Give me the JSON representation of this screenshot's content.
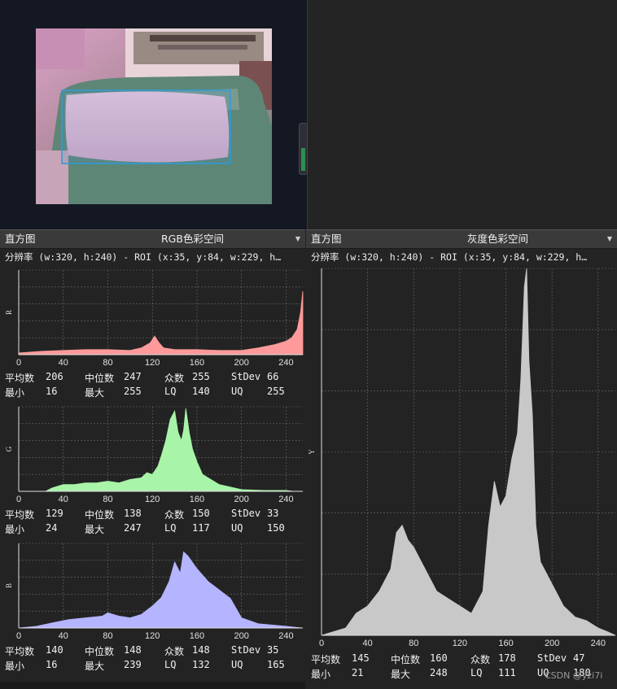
{
  "window": {
    "preview": {
      "roi_color": "#2f9ad8"
    }
  },
  "panels": [
    {
      "id": "rgb",
      "title": "直方图",
      "mode": "RGB色彩空间",
      "resolution": "分辨率 (w:320, h:240) - ROI (x:35, y:84, w:229, h…",
      "channels": [
        {
          "letter": "R",
          "color": "#ff9a9a",
          "x_ticks": [
            "0",
            "40",
            "80",
            "120",
            "160",
            "200",
            "240"
          ],
          "stats": {
            "mean_label": "平均数",
            "mean": "206",
            "median_label": "中位数",
            "median": "247",
            "mode_label": "众数",
            "mode": "255",
            "stdev_label": "StDev",
            "stdev": "66",
            "min_label": "最小",
            "min": "16",
            "max_label": "最大",
            "max": "255",
            "lq_label": "LQ",
            "lq": "140",
            "uq_label": "UQ",
            "uq": "255"
          }
        },
        {
          "letter": "G",
          "color": "#a8f4a8",
          "x_ticks": [
            "0",
            "40",
            "80",
            "120",
            "160",
            "200",
            "240"
          ],
          "stats": {
            "mean_label": "平均数",
            "mean": "129",
            "median_label": "中位数",
            "median": "138",
            "mode_label": "众数",
            "mode": "150",
            "stdev_label": "StDev",
            "stdev": "33",
            "min_label": "最小",
            "min": "24",
            "max_label": "最大",
            "max": "247",
            "lq_label": "LQ",
            "lq": "117",
            "uq_label": "UQ",
            "uq": "150"
          }
        },
        {
          "letter": "B",
          "color": "#b4b4ff",
          "x_ticks": [
            "0",
            "40",
            "80",
            "120",
            "160",
            "200",
            "240"
          ],
          "stats": {
            "mean_label": "平均数",
            "mean": "140",
            "median_label": "中位数",
            "median": "148",
            "mode_label": "众数",
            "mode": "148",
            "stdev_label": "StDev",
            "stdev": "35",
            "min_label": "最小",
            "min": "16",
            "max_label": "最大",
            "max": "239",
            "lq_label": "LQ",
            "lq": "132",
            "uq_label": "UQ",
            "uq": "165"
          }
        }
      ]
    },
    {
      "id": "gray",
      "title": "直方图",
      "mode": "灰度色彩空间",
      "resolution": "分辨率 (w:320, h:240) - ROI (x:35, y:84, w:229, h…",
      "channels": [
        {
          "letter": "Y",
          "color": "#c8c8c8",
          "x_ticks": [
            "0",
            "40",
            "80",
            "120",
            "160",
            "200",
            "240"
          ],
          "stats": {
            "mean_label": "平均数",
            "mean": "145",
            "median_label": "中位数",
            "median": "160",
            "mode_label": "众数",
            "mode": "178",
            "stdev_label": "StDev",
            "stdev": "47",
            "min_label": "最小",
            "min": "21",
            "max_label": "最大",
            "max": "248",
            "lq_label": "LQ",
            "lq": "111",
            "uq_label": "UQ",
            "uq": "180"
          }
        }
      ]
    }
  ],
  "watermark": "CSDN @yzi7i",
  "chart_data": [
    {
      "type": "area",
      "series": [
        {
          "name": "R",
          "x": [
            0,
            20,
            40,
            60,
            80,
            100,
            110,
            118,
            122,
            126,
            130,
            140,
            160,
            180,
            200,
            215,
            230,
            240,
            245,
            250,
            253,
            255
          ],
          "values": [
            0.02,
            0.04,
            0.05,
            0.06,
            0.06,
            0.05,
            0.08,
            0.14,
            0.22,
            0.14,
            0.08,
            0.06,
            0.06,
            0.05,
            0.05,
            0.08,
            0.12,
            0.16,
            0.2,
            0.3,
            0.5,
            0.75
          ]
        }
      ],
      "xlim": [
        0,
        255
      ]
    },
    {
      "type": "area",
      "series": [
        {
          "name": "G",
          "x": [
            0,
            24,
            30,
            40,
            50,
            60,
            70,
            80,
            90,
            100,
            110,
            115,
            120,
            125,
            128,
            132,
            136,
            140,
            143,
            146,
            148,
            150,
            153,
            156,
            160,
            165,
            170,
            180,
            200,
            220,
            240,
            247,
            255
          ],
          "values": [
            0,
            0,
            0.04,
            0.08,
            0.08,
            0.1,
            0.1,
            0.12,
            0.1,
            0.14,
            0.16,
            0.22,
            0.2,
            0.3,
            0.42,
            0.6,
            0.85,
            0.95,
            0.7,
            0.6,
            0.72,
            0.98,
            0.7,
            0.5,
            0.35,
            0.2,
            0.16,
            0.08,
            0.02,
            0.01,
            0.01,
            0,
            0
          ]
        }
      ],
      "xlim": [
        0,
        255
      ]
    },
    {
      "type": "area",
      "series": [
        {
          "name": "B",
          "x": [
            0,
            16,
            30,
            45,
            60,
            75,
            80,
            90,
            100,
            110,
            120,
            128,
            135,
            140,
            145,
            148,
            152,
            160,
            170,
            180,
            190,
            200,
            215,
            240,
            255
          ],
          "values": [
            0,
            0.02,
            0.06,
            0.1,
            0.12,
            0.14,
            0.18,
            0.14,
            0.12,
            0.16,
            0.26,
            0.36,
            0.55,
            0.78,
            0.65,
            0.9,
            0.85,
            0.7,
            0.55,
            0.45,
            0.35,
            0.12,
            0.05,
            0.02,
            0
          ]
        }
      ],
      "xlim": [
        0,
        255
      ]
    },
    {
      "type": "area",
      "series": [
        {
          "name": "Y",
          "x": [
            0,
            21,
            30,
            40,
            50,
            60,
            65,
            70,
            75,
            80,
            90,
            100,
            110,
            120,
            130,
            140,
            145,
            150,
            155,
            160,
            165,
            170,
            173,
            176,
            178,
            180,
            183,
            186,
            190,
            200,
            210,
            220,
            230,
            240,
            248,
            255
          ],
          "values": [
            0,
            0.02,
            0.06,
            0.08,
            0.12,
            0.18,
            0.28,
            0.3,
            0.26,
            0.24,
            0.18,
            0.12,
            0.1,
            0.08,
            0.06,
            0.12,
            0.3,
            0.42,
            0.35,
            0.38,
            0.48,
            0.55,
            0.7,
            0.95,
            1.0,
            0.75,
            0.6,
            0.3,
            0.2,
            0.14,
            0.08,
            0.05,
            0.04,
            0.02,
            0.01,
            0
          ]
        }
      ],
      "xlim": [
        0,
        255
      ]
    }
  ]
}
